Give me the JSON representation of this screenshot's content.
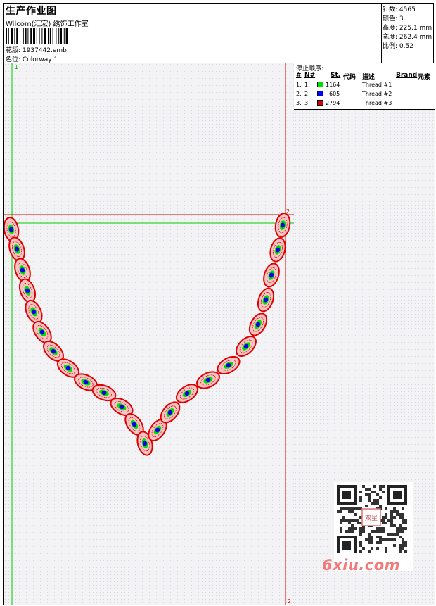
{
  "header": {
    "title": "生产作业图",
    "company": "Wilcom(汇宏) 绣饰工作室",
    "design_label": "花版:",
    "design_value": "1937442.emb",
    "colorway_label": "色位:",
    "colorway_value": "Colorway 1"
  },
  "stats": [
    {
      "label": "针数:",
      "value": "4565"
    },
    {
      "label": "颜色:",
      "value": "3"
    },
    {
      "label": "高度:",
      "value": "225.1 mm"
    },
    {
      "label": "宽度:",
      "value": "262.4 mm"
    },
    {
      "label": "比例:",
      "value": "0.52"
    }
  ],
  "stop_sequence": {
    "title": "停止顺序:",
    "headers": {
      "hash": "#",
      "n": "N#",
      "st": "St.",
      "code": "代码",
      "desc": "描述",
      "brand": "Brand",
      "element": "元素"
    },
    "rows": [
      {
        "idx": "1.",
        "n": "1",
        "color": "#00e000",
        "code": "1164",
        "desc": "Thread #1"
      },
      {
        "idx": "2.",
        "n": "2",
        "color": "#0000f0",
        "code": "605",
        "desc": "Thread #2"
      },
      {
        "idx": "3.",
        "n": "3",
        "color": "#e00000",
        "code": "2794",
        "desc": "Thread #3"
      }
    ]
  },
  "markers": {
    "m1": "1",
    "m2": "2",
    "m2_bottom": "2"
  },
  "watermark": {
    "site": "6xiu.com",
    "stamp_text": "双星"
  },
  "colors": {
    "green": "#00e000",
    "blue": "#0000f0",
    "red": "#e00000"
  }
}
